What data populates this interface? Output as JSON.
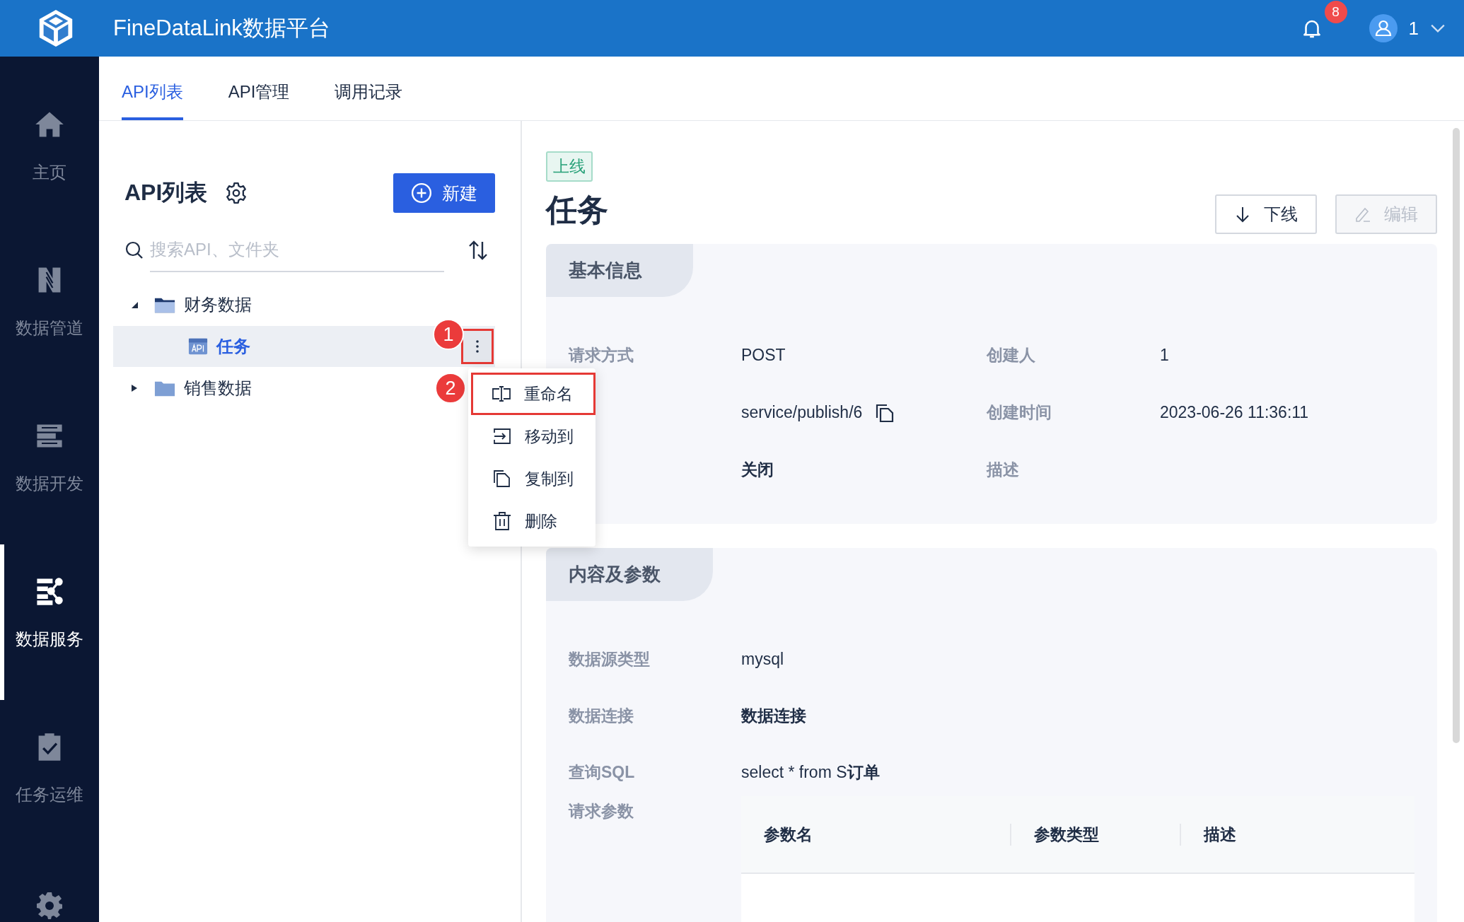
{
  "header": {
    "title": "FineDataLink数据平台",
    "notification_count": "8",
    "user": "1"
  },
  "sidebar": {
    "items": [
      {
        "label": "主页",
        "selected": false
      },
      {
        "label": "数据管道",
        "selected": false
      },
      {
        "label": "数据开发",
        "selected": false
      },
      {
        "label": "数据服务",
        "selected": true
      },
      {
        "label": "任务运维",
        "selected": false
      }
    ]
  },
  "tabs": [
    {
      "label": "API列表",
      "selected": true
    },
    {
      "label": "API管理",
      "selected": false
    },
    {
      "label": "调用记录",
      "selected": false
    }
  ],
  "panel": {
    "title": "API列表",
    "new_button": "新建",
    "search": {
      "placeholder": "搜索API、文件夹"
    },
    "tree": [
      {
        "label": "财务数据",
        "kind": "folder",
        "expanded": true,
        "selected": false,
        "children": [
          {
            "label": "任务",
            "kind": "api",
            "selected": true
          }
        ]
      },
      {
        "label": "销售数据",
        "kind": "folder",
        "expanded": false,
        "selected": false
      }
    ],
    "step_markers": [
      "1",
      "2"
    ],
    "context_menu": [
      {
        "label": "重命名",
        "highlighted": true
      },
      {
        "label": "移动到",
        "highlighted": false
      },
      {
        "label": "复制到",
        "highlighted": false
      },
      {
        "label": "删除",
        "highlighted": false
      }
    ]
  },
  "detail": {
    "status_tag": "上线",
    "title": "任务",
    "buttons": [
      {
        "label": "下线",
        "disabled": false
      },
      {
        "label": "编辑",
        "disabled": true
      }
    ],
    "basic_info": {
      "title": "基本信息",
      "rows": [
        [
          {
            "label": "请求方式",
            "value": "POST"
          },
          {
            "label": "创建人",
            "value": "1"
          }
        ],
        [
          {
            "value": "service/publish/6",
            "copy": true
          },
          {
            "label": "创建时间",
            "value": "2023-06-26 11:36:11"
          }
        ],
        [
          {
            "value": "关闭",
            "bold": true
          },
          {
            "label": "描述"
          }
        ]
      ]
    },
    "content": {
      "title": "内容及参数",
      "rows": [
        {
          "label": "数据源类型",
          "value": "mysql"
        },
        {
          "label": "数据连接",
          "value": "数据连接",
          "bold": true
        },
        {
          "label": "查询SQL",
          "value": "select * from S**订单**"
        }
      ],
      "params_label": "请求参数",
      "params_columns": [
        "参数名",
        "参数类型",
        "描述"
      ]
    }
  }
}
